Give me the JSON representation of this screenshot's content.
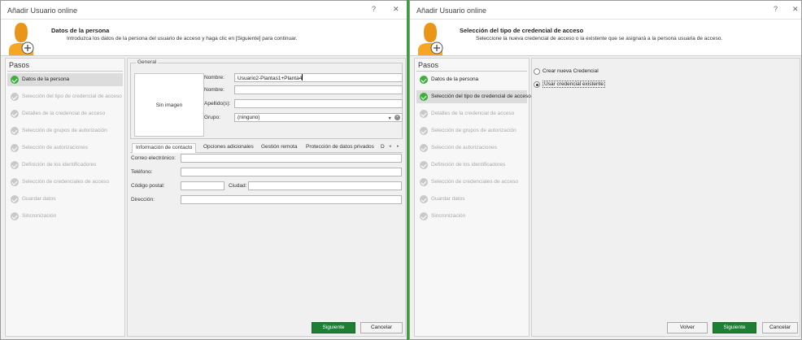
{
  "dialog1": {
    "title": "Añadir Usuario online",
    "help_glyph": "?",
    "close_glyph": "✕",
    "header": {
      "title": "Datos de la persona",
      "description": "Introduzca los datos de la persona del usuario de acceso y haga clic en [Siguiente] para continuar."
    },
    "steps_title": "Pasos",
    "steps": [
      "Datos de la persona",
      "Selección del tipo de credencial de acceso",
      "Detalles de la credencial de acceso",
      "Selección de grupos de autorización",
      "Selección de autorizaciones",
      "Definición de los identificadores",
      "Selección de credenciales de acceso",
      "Guardar datos",
      "Sincronización"
    ],
    "general": {
      "legend": "General",
      "photo_label": "Sin imagen",
      "nombre_label": "Nombre:",
      "nombre_value": "Usuario2-Plantas1+Planta4",
      "nombre2_label": "Nombre:",
      "nombre2_value": "",
      "apellidos_label": "Apellido(s):",
      "apellidos_value": "",
      "grupo_label": "Grupo:",
      "grupo_value": "(ninguno)"
    },
    "tabs": [
      "Información de contacto",
      "Opciones adicionales",
      "Gestión remota",
      "Protección de datos privados",
      "D"
    ],
    "contact": {
      "email_label": "Correo electrónico:",
      "email_value": "",
      "phone_label": "Teléfono:",
      "phone_value": "",
      "zip_label": "Código postal:",
      "zip_value": "",
      "city_label": "Ciudad:",
      "city_value": "",
      "address_label": "Dirección:",
      "address_value": ""
    },
    "buttons": {
      "next": "Siguiente",
      "cancel": "Cancelar"
    }
  },
  "dialog2": {
    "title": "Añadir Usuario online",
    "help_glyph": "?",
    "close_glyph": "✕",
    "header": {
      "title": "Selección del tipo de credencial de acceso",
      "description": "Seleccione la nueva credencial de acceso o la existente que se asignará a la persona usuaria de acceso."
    },
    "steps_title": "Pasos",
    "steps": [
      "Datos de la persona",
      "Selección del tipo de credencial de acceso",
      "Detalles de la credencial de acceso",
      "Selección de grupos de autorización",
      "Selección de autorizaciones",
      "Definición de los identificadores",
      "Selección de credenciales de acceso",
      "Guardar datos",
      "Sincronización"
    ],
    "options": [
      "Crear nueva Credencial",
      "Usar credencial existente"
    ],
    "selected_option": "Usar credencial existente",
    "buttons": {
      "back": "Volver",
      "next": "Siguiente",
      "cancel": "Cancelar"
    }
  },
  "colors": {
    "accent": "#3bb03b",
    "primary_button": "#1e7e34",
    "step_inactive": "#a9a9a9"
  },
  "icons": [
    "user-add-icon",
    "check-circle-icon",
    "dropdown-arrow-icon",
    "clear-icon",
    "tab-scroll-left-icon",
    "tab-scroll-right-icon"
  ]
}
